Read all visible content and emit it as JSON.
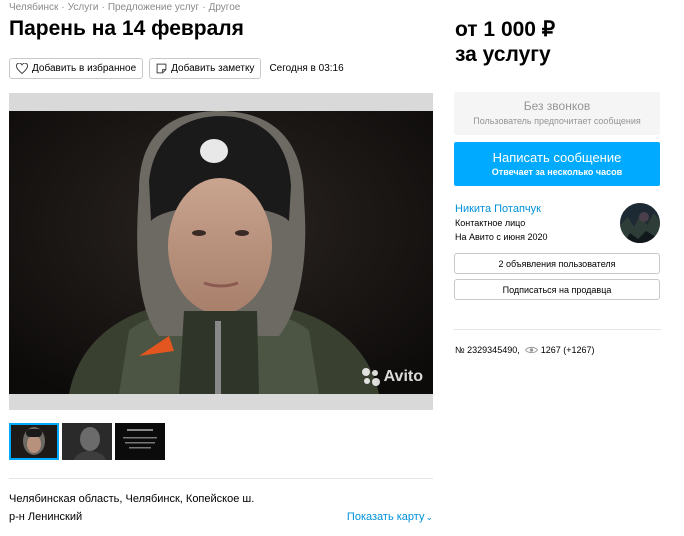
{
  "breadcrumb": [
    "Челябинск",
    "Услуги",
    "Предложение услуг",
    "Другое"
  ],
  "listing": {
    "title": "Парень на 14 февраля",
    "add_favorite": "Добавить в избранное",
    "add_note": "Добавить заметку",
    "date": "Сегодня в 03:16",
    "watermark": "Avito"
  },
  "location": {
    "address": "Челябинская область, Челябинск, Копейское ш.",
    "district": "р-н Ленинский",
    "show_map": "Показать карту"
  },
  "price": {
    "amount": "от 1 000 ₽",
    "unit": "за услугу"
  },
  "contact": {
    "no_calls_title": "Без звонков",
    "no_calls_sub": "Пользователь предпочитает сообщения",
    "write_title": "Написать сообщение",
    "write_sub": "Отвечает за несколько часов"
  },
  "seller": {
    "name": "Никита Потапчук",
    "role": "Контактное лицо",
    "since": "На Авито с июня 2020",
    "listings_button": "2 объявления пользователя",
    "subscribe_button": "Подписаться на продавца"
  },
  "stats": {
    "number": "№ 2329345490,",
    "views": "1267 (+1267)"
  },
  "colors": {
    "accent": "#00aaff",
    "link": "#0091d9"
  }
}
